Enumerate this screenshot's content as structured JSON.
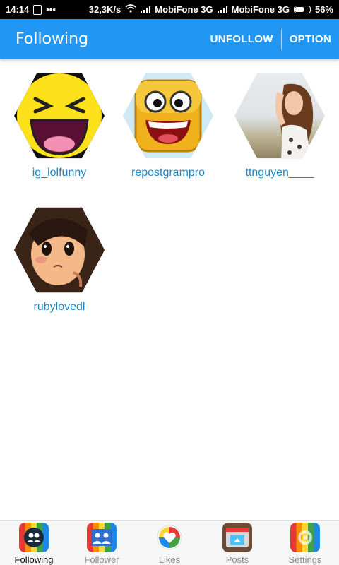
{
  "status": {
    "time": "14:14",
    "dots": "•••",
    "speed": "32,3K/s",
    "carrier1": "MobiFone 3G",
    "carrier2": "MobiFone 3G",
    "battery": "56%"
  },
  "appbar": {
    "title": "Following",
    "unfollow": "UNFOLLOW",
    "option": "OPTION"
  },
  "users": [
    {
      "name": "ig_lolfunny",
      "avatar": "laughing-emoji"
    },
    {
      "name": "repostgrampro",
      "avatar": "smiling-box-face"
    },
    {
      "name": "ttnguyen____",
      "avatar": "woman-photo"
    },
    {
      "name": "rubylovedl",
      "avatar": "anime-girl-drawing"
    }
  ],
  "tabs": [
    {
      "label": "Following",
      "icon": "following-icon",
      "active": true
    },
    {
      "label": "Follower",
      "icon": "follower-icon",
      "active": false
    },
    {
      "label": "Likes",
      "icon": "likes-icon",
      "active": false
    },
    {
      "label": "Posts",
      "icon": "posts-icon",
      "active": false
    },
    {
      "label": "Settings",
      "icon": "settings-icon",
      "active": false
    }
  ],
  "colors": {
    "accent": "#2196f3",
    "username": "#1e88c7"
  }
}
